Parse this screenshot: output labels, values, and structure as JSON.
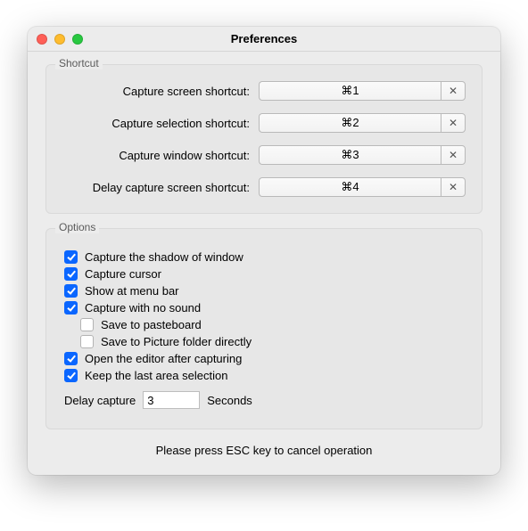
{
  "window_title": "Preferences",
  "shortcut_group": {
    "label": "Shortcut",
    "rows": [
      {
        "label": "Capture screen shortcut:",
        "value": "⌘1"
      },
      {
        "label": "Capture selection shortcut:",
        "value": "⌘2"
      },
      {
        "label": "Capture window shortcut:",
        "value": "⌘3"
      },
      {
        "label": "Delay capture screen shortcut:",
        "value": "⌘4"
      }
    ]
  },
  "options_group": {
    "label": "Options",
    "items": [
      {
        "label": "Capture the shadow of window",
        "checked": true,
        "indent": false
      },
      {
        "label": "Capture cursor",
        "checked": true,
        "indent": false
      },
      {
        "label": "Show at menu bar",
        "checked": true,
        "indent": false
      },
      {
        "label": "Capture with no sound",
        "checked": true,
        "indent": false
      },
      {
        "label": "Save to pasteboard",
        "checked": false,
        "indent": true
      },
      {
        "label": "Save to Picture folder directly",
        "checked": false,
        "indent": true
      },
      {
        "label": "Open the editor after capturing",
        "checked": true,
        "indent": false
      },
      {
        "label": "Keep the last area selection",
        "checked": true,
        "indent": false
      }
    ],
    "delay": {
      "label": "Delay capture",
      "value": "3",
      "unit": "Seconds"
    }
  },
  "footer_note": "Please press ESC key to cancel operation"
}
